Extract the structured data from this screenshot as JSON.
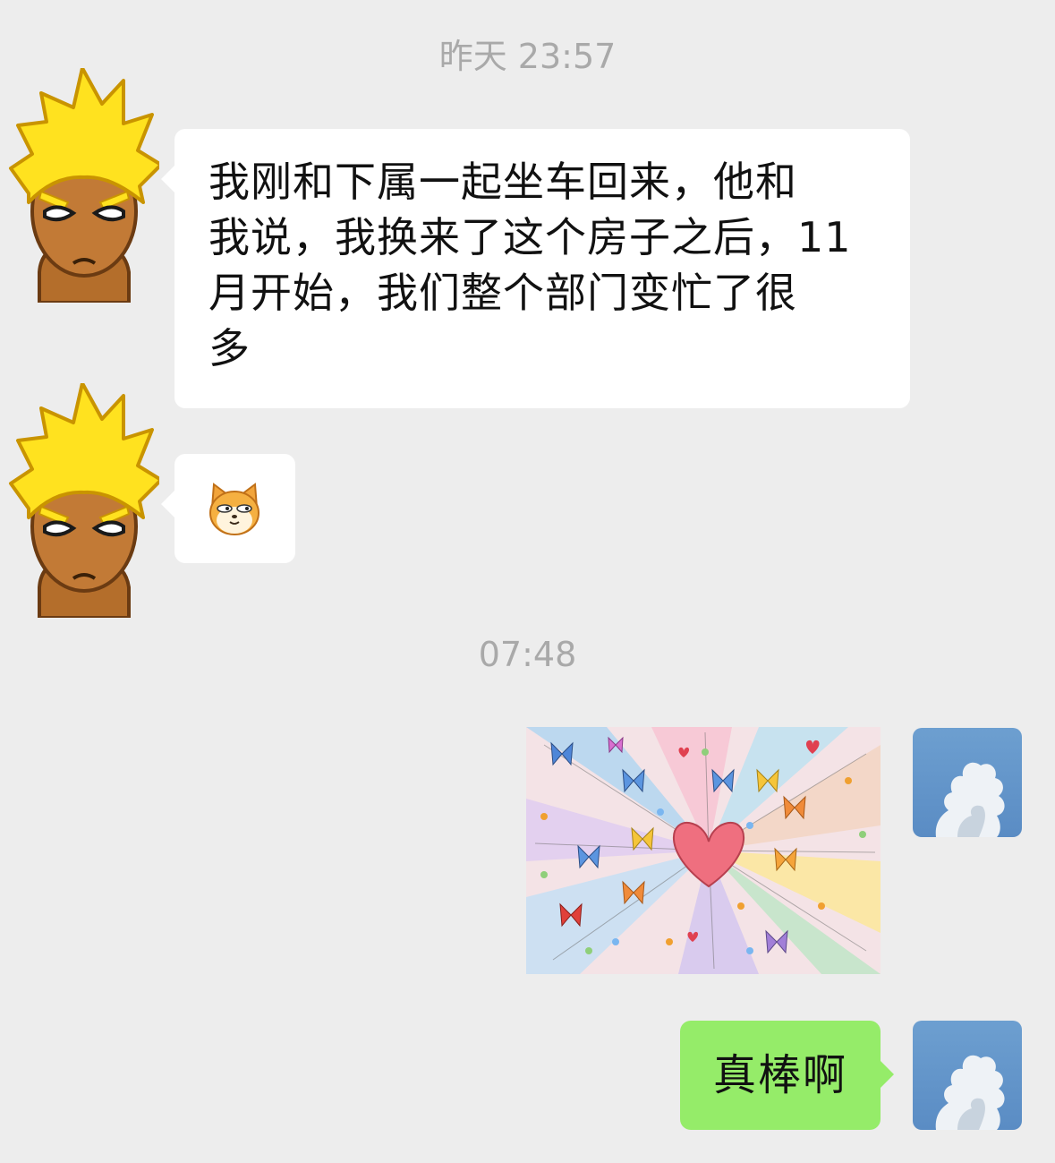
{
  "timestamps": {
    "first": "昨天 23:57",
    "second": "07:48"
  },
  "messages": {
    "incoming_text": {
      "lines": [
        "我刚和下属一起坐车回来，他和",
        "我说，我换来了这个房子之后，11",
        "月开始，我们整个部门变忙了很",
        "多"
      ]
    },
    "incoming_emoji": {
      "icon": "shiba-dog-emoji-icon"
    },
    "outgoing_image": {
      "icon": "heart-butterflies-image"
    },
    "outgoing_text": "真棒啊"
  },
  "avatars": {
    "contact": "flame-hair-cartoon-avatar",
    "self": "cloud-sky-avatar"
  },
  "colors": {
    "background": "#ededed",
    "incoming_bubble": "#ffffff",
    "outgoing_bubble": "#95ec69",
    "timestamp": "#a9a9a9"
  }
}
